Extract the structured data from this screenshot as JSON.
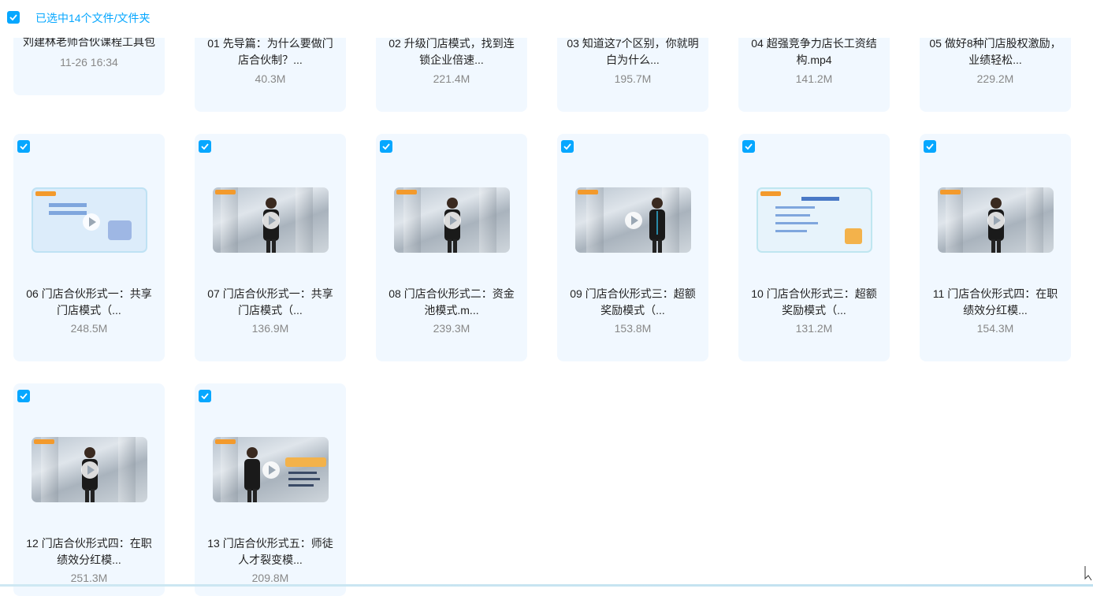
{
  "header": {
    "selection_label": "已选中14个文件/文件夹",
    "checkbox_icon": "checkbox-checked-icon",
    "accent_color": "#06a7ff"
  },
  "top_row": [
    {
      "name": "刘建林老师合伙课程工具包",
      "meta": "11-26 16:34"
    },
    {
      "name": "01 先导篇：为什么要做门店合伙制？...",
      "meta": "40.3M"
    },
    {
      "name": "02 升级门店模式，找到连锁企业倍速...",
      "meta": "221.4M"
    },
    {
      "name": "03 知道这7个区别，你就明白为什么...",
      "meta": "195.7M"
    },
    {
      "name": "04 超强竞争力店长工资结构.mp4",
      "meta": "141.2M"
    },
    {
      "name": "05 做好8种门店股权激励，业绩轻松...",
      "meta": "229.2M"
    }
  ],
  "files": [
    {
      "name": "06 门店合伙形式一：共享门店模式（...",
      "size": "248.5M",
      "thumb": "slide"
    },
    {
      "name": "07 门店合伙形式一：共享门店模式（...",
      "size": "136.9M",
      "thumb": "video"
    },
    {
      "name": "08 门店合伙形式二：资金池模式.m...",
      "size": "239.3M",
      "thumb": "video"
    },
    {
      "name": "09 门店合伙形式三：超额奖励模式（...",
      "size": "153.8M",
      "thumb": "video"
    },
    {
      "name": "10 门店合伙形式三：超额奖励模式（...",
      "size": "131.2M",
      "thumb": "slide2"
    },
    {
      "name": "11 门店合伙形式四：在职绩效分红模...",
      "size": "154.3M",
      "thumb": "video"
    },
    {
      "name": "12 门店合伙形式四：在职绩效分红模...",
      "size": "251.3M",
      "thumb": "video"
    },
    {
      "name": "13 门店合伙形式五：师徒人才裂变模...",
      "size": "209.8M",
      "thumb": "video"
    }
  ]
}
